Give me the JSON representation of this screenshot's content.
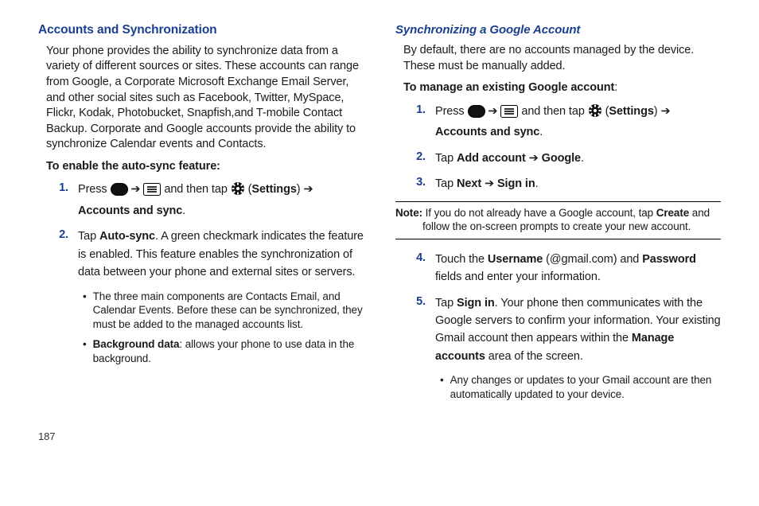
{
  "page_num": "187",
  "left": {
    "h2": "Accounts and Synchronization",
    "intro": "Your phone provides the ability to synchronize data from a variety of different sources or sites. These accounts can range from Google, a Corporate Microsoft Exchange Email Server, and other social sites such as Facebook, Twitter, MySpace, Flickr, Kodak, Photobucket, Snapfish,and T-mobile Contact Backup. Corporate and Google accounts provide the ability to synchronize Calendar events and Contacts.",
    "enable_heading": "To enable the auto-sync feature:",
    "step1_a": "Press ",
    "arrow": " ➔ ",
    "step1_b": " and then tap ",
    "step1_settings_open": " (",
    "step1_settings": "Settings",
    "step1_settings_close": ") ➔ ",
    "step1_accounts": "Accounts and sync",
    "step1_dot": ".",
    "step2_a": "Tap ",
    "step2_auto": "Auto-sync",
    "step2_b": ". A green checkmark indicates the feature is enabled. This feature enables the synchronization of data between your phone and external sites or servers.",
    "bullet1": "The three main components are Contacts Email, and Calendar Events. Before these can be synchronized, they must be added to the managed accounts list.",
    "bullet2_a": "Background data",
    "bullet2_b": ": allows your phone to use data in the background."
  },
  "right": {
    "h3": "Synchronizing a Google Account",
    "intro": "By default, there are no accounts managed by the device. These must be manually added.",
    "manage_heading": "To manage an existing Google account",
    "manage_heading_colon": ":",
    "step1_a": "Press ",
    "arrow": " ➔ ",
    "step1_b": " and then tap ",
    "step1_settings_open": " (",
    "step1_settings": "Settings",
    "step1_settings_close": ") ➔ ",
    "step1_accounts": "Accounts and sync",
    "step1_dot": ".",
    "step2_a": "Tap ",
    "step2_add": "Add account",
    "step2_ar": " ➔ ",
    "step2_google": "Google",
    "step2_dot": ".",
    "step3_a": "Tap ",
    "step3_next": "Next",
    "step3_ar": " ➔ ",
    "step3_sign": "Sign in",
    "step3_dot": ".",
    "note_a": "Note:",
    "note_b": " If you do not already have a Google account, tap ",
    "note_create": "Create",
    "note_c": " and follow the on-screen prompts to create your new account.",
    "step4_a": "Touch the ",
    "step4_user": "Username",
    "step4_b": " (@gmail.com) and ",
    "step4_pw": "Password",
    "step4_c": " fields and enter your information.",
    "step5_a": "Tap ",
    "step5_sign": "Sign in",
    "step5_b": ". Your phone then communicates with the Google servers to confirm your information. Your existing Gmail account then appears within the ",
    "step5_manage": "Manage accounts",
    "step5_c": " area of the screen.",
    "bullet": "Any changes or updates to your Gmail account are then automatically updated to your device."
  }
}
